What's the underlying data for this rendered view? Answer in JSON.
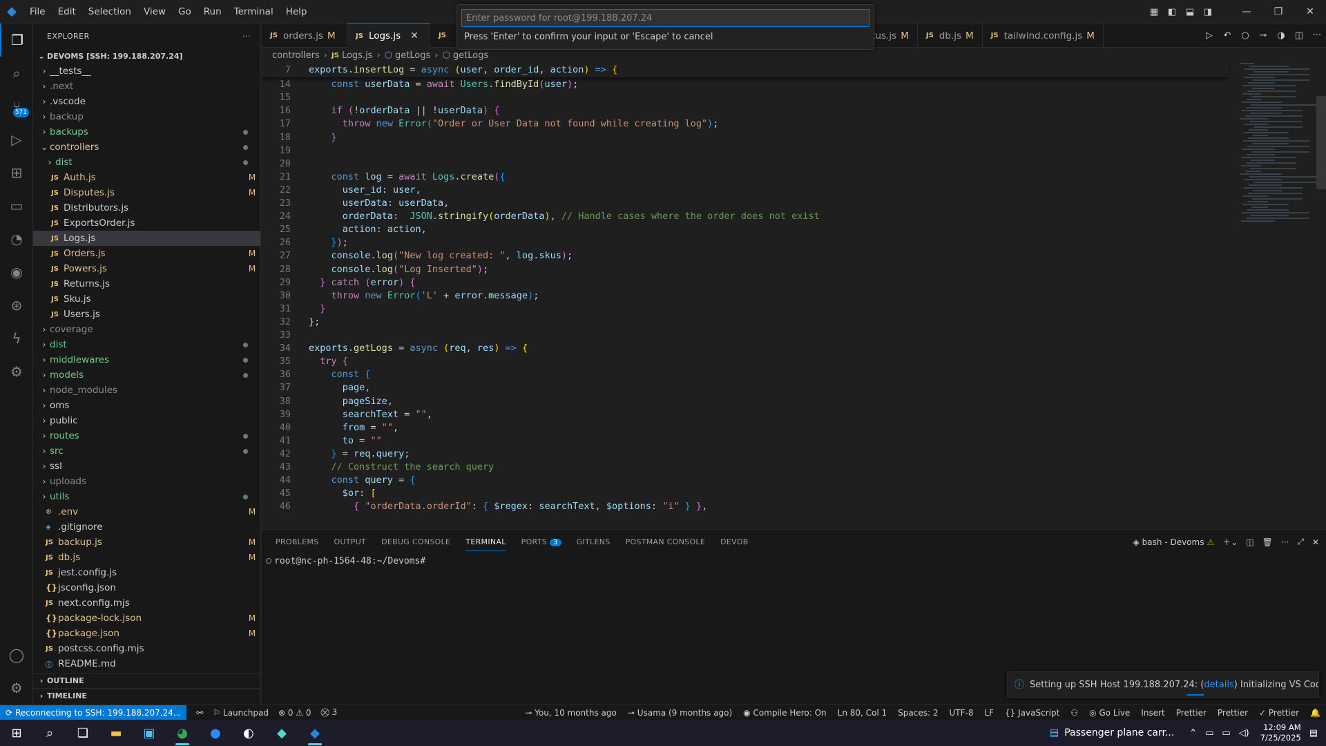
{
  "menu": [
    "File",
    "Edit",
    "Selection",
    "View",
    "Go",
    "Run",
    "Terminal",
    "Help"
  ],
  "quick_input": {
    "placeholder": "Enter password for root@199.188.207.24",
    "hint": "Press 'Enter' to confirm your input or 'Escape' to cancel"
  },
  "activity": {
    "scm_badge": "571"
  },
  "explorer": {
    "title": "EXPLORER",
    "root": "DEVOMS [SSH: 199.188.207.24]",
    "items": [
      {
        "label": "__tests__",
        "type": "folder",
        "indent": 0,
        "open": false,
        "status": "",
        "color": "norm"
      },
      {
        "label": ".next",
        "type": "folder",
        "indent": 0,
        "open": false,
        "status": "",
        "color": "dim"
      },
      {
        "label": ".vscode",
        "type": "folder",
        "indent": 0,
        "open": false,
        "status": "",
        "color": "norm"
      },
      {
        "label": "backup",
        "type": "folder",
        "indent": 0,
        "open": false,
        "status": "",
        "color": "dim"
      },
      {
        "label": "backups",
        "type": "folder",
        "indent": 0,
        "open": false,
        "status": "dot",
        "color": "green"
      },
      {
        "label": "controllers",
        "type": "folder",
        "indent": 0,
        "open": true,
        "status": "dot",
        "color": "mod"
      },
      {
        "label": "dist",
        "type": "folder",
        "indent": 1,
        "open": false,
        "status": "dot",
        "color": "green"
      },
      {
        "label": "Auth.js",
        "type": "js",
        "indent": 1,
        "status": "M",
        "color": "mod"
      },
      {
        "label": "Disputes.js",
        "type": "js",
        "indent": 1,
        "status": "M",
        "color": "mod"
      },
      {
        "label": "Distributors.js",
        "type": "js",
        "indent": 1,
        "status": "",
        "color": "norm"
      },
      {
        "label": "ExportsOrder.js",
        "type": "js",
        "indent": 1,
        "status": "",
        "color": "norm"
      },
      {
        "label": "Logs.js",
        "type": "js",
        "indent": 1,
        "status": "",
        "color": "norm",
        "selected": true
      },
      {
        "label": "Orders.js",
        "type": "js",
        "indent": 1,
        "status": "M",
        "color": "mod"
      },
      {
        "label": "Powers.js",
        "type": "js",
        "indent": 1,
        "status": "M",
        "color": "mod"
      },
      {
        "label": "Returns.js",
        "type": "js",
        "indent": 1,
        "status": "",
        "color": "norm"
      },
      {
        "label": "Sku.js",
        "type": "js",
        "indent": 1,
        "status": "",
        "color": "norm"
      },
      {
        "label": "Users.js",
        "type": "js",
        "indent": 1,
        "status": "",
        "color": "norm"
      },
      {
        "label": "coverage",
        "type": "folder",
        "indent": 0,
        "open": false,
        "status": "",
        "color": "dim"
      },
      {
        "label": "dist",
        "type": "folder",
        "indent": 0,
        "open": false,
        "status": "dot",
        "color": "green"
      },
      {
        "label": "middlewares",
        "type": "folder",
        "indent": 0,
        "open": false,
        "status": "dot",
        "color": "green"
      },
      {
        "label": "models",
        "type": "folder",
        "indent": 0,
        "open": false,
        "status": "dot",
        "color": "green"
      },
      {
        "label": "node_modules",
        "type": "folder",
        "indent": 0,
        "open": false,
        "status": "",
        "color": "dim"
      },
      {
        "label": "oms",
        "type": "folder",
        "indent": 0,
        "open": false,
        "status": "",
        "color": "norm"
      },
      {
        "label": "public",
        "type": "folder",
        "indent": 0,
        "open": false,
        "status": "",
        "color": "norm"
      },
      {
        "label": "routes",
        "type": "folder",
        "indent": 0,
        "open": false,
        "status": "dot",
        "color": "green"
      },
      {
        "label": "src",
        "type": "folder",
        "indent": 0,
        "open": false,
        "status": "dot",
        "color": "green"
      },
      {
        "label": "ssl",
        "type": "folder",
        "indent": 0,
        "open": false,
        "status": "",
        "color": "norm"
      },
      {
        "label": "uploads",
        "type": "folder",
        "indent": 0,
        "open": false,
        "status": "",
        "color": "dim"
      },
      {
        "label": "utils",
        "type": "folder",
        "indent": 0,
        "open": false,
        "status": "dot",
        "color": "green"
      },
      {
        "label": ".env",
        "type": "env",
        "indent": 0,
        "status": "M",
        "color": "mod"
      },
      {
        "label": ".gitignore",
        "type": "git",
        "indent": 0,
        "status": "",
        "color": "norm"
      },
      {
        "label": "backup.js",
        "type": "js",
        "indent": 0,
        "status": "M",
        "color": "mod"
      },
      {
        "label": "db.js",
        "type": "js",
        "indent": 0,
        "status": "M",
        "color": "mod"
      },
      {
        "label": "jest.config.js",
        "type": "js",
        "indent": 0,
        "status": "",
        "color": "norm"
      },
      {
        "label": "jsconfig.json",
        "type": "json",
        "indent": 0,
        "status": "",
        "color": "norm"
      },
      {
        "label": "next.config.mjs",
        "type": "js",
        "indent": 0,
        "status": "",
        "color": "norm"
      },
      {
        "label": "package-lock.json",
        "type": "json",
        "indent": 0,
        "status": "M",
        "color": "mod"
      },
      {
        "label": "package.json",
        "type": "json",
        "indent": 0,
        "status": "M",
        "color": "mod"
      },
      {
        "label": "postcss.config.mjs",
        "type": "js",
        "indent": 0,
        "status": "",
        "color": "norm"
      },
      {
        "label": "README.md",
        "type": "info",
        "indent": 0,
        "status": "",
        "color": "norm"
      }
    ],
    "outline": "OUTLINE",
    "timeline": "TIMELINE"
  },
  "tabs": [
    {
      "label": "orders.js",
      "modified": "M",
      "active": false
    },
    {
      "label": "Logs.js",
      "modified": "",
      "active": true
    },
    {
      "label": "",
      "modified": "",
      "active": false,
      "hidden": true
    },
    {
      "label": "HandleSkus.js",
      "modified": "M",
      "active": false
    },
    {
      "label": "db.js",
      "modified": "M",
      "active": false
    },
    {
      "label": "tailwind.config.js",
      "modified": "M",
      "active": false
    }
  ],
  "breadcrumb": [
    "controllers",
    "Logs.js",
    "getLogs",
    "getLogs"
  ],
  "code": [
    {
      "n": "13",
      "html": ""
    },
    {
      "n": "14",
      "html": "    <span class='k'>const</span> <span class='v'>userData</span> = <span class='kw'>await</span> <span class='cl'>Users</span>.<span class='f'>findById</span><span class='pp'>(</span><span class='v'>user</span><span class='pp'>)</span>;"
    },
    {
      "n": "15",
      "html": ""
    },
    {
      "n": "16",
      "html": "    <span class='kw'>if</span> <span class='pp'>(</span>!<span class='v'>orderData</span> || !<span class='v'>userData</span><span class='pp'>)</span> <span class='pp'>{</span>"
    },
    {
      "n": "17",
      "html": "      <span class='kw'>throw</span> <span class='k'>new</span> <span class='cl'>Error</span><span class='pb'>(</span><span class='s'>\"Order or User Data not found while creating log\"</span><span class='pb'>)</span>;"
    },
    {
      "n": "18",
      "html": "    <span class='pp'>}</span>"
    },
    {
      "n": "19",
      "html": ""
    },
    {
      "n": "20",
      "html": ""
    },
    {
      "n": "21",
      "html": "    <span class='k'>const</span> <span class='v'>log</span> = <span class='kw'>await</span> <span class='cl'>Logs</span>.<span class='f'>create</span><span class='pp'>(</span><span class='pb'>{</span>"
    },
    {
      "n": "22",
      "html": "      <span class='v'>user_id</span>: <span class='v'>user</span>,"
    },
    {
      "n": "23",
      "html": "      <span class='v'>userData</span>: <span class='v'>userData</span>,"
    },
    {
      "n": "24",
      "html": "      <span class='v'>orderData</span>:  <span class='cl'>JSON</span>.<span class='f'>stringify</span><span class='p'>(</span><span class='v'>orderData</span><span class='p'>)</span>, <span class='cm'>// Handle cases where the order does not exist</span>"
    },
    {
      "n": "25",
      "html": "      <span class='v'>action</span>: <span class='v'>action</span>,"
    },
    {
      "n": "26",
      "html": "    <span class='pb'>}</span><span class='pp'>)</span>;"
    },
    {
      "n": "27",
      "html": "    <span class='v'>console</span>.<span class='f'>log</span><span class='pp'>(</span><span class='s'>\"New log created: \"</span>, <span class='v'>log</span>.<span class='v'>skus</span><span class='pp'>)</span>;"
    },
    {
      "n": "28",
      "html": "    <span class='v'>console</span>.<span class='f'>log</span><span class='pp'>(</span><span class='s'>\"Log Inserted\"</span><span class='pp'>)</span>;"
    },
    {
      "n": "29",
      "html": "  <span class='pp'>}</span> <span class='kw'>catch</span> <span class='pp'>(</span><span class='v'>error</span><span class='pp'>)</span> <span class='pp'>{</span>"
    },
    {
      "n": "30",
      "html": "    <span class='kw'>throw</span> <span class='k'>new</span> <span class='cl'>Error</span><span class='pb'>(</span><span class='s'>'L'</span> + <span class='v'>error</span>.<span class='v'>message</span><span class='pb'>)</span>;"
    },
    {
      "n": "31",
      "html": "  <span class='pp'>}</span>"
    },
    {
      "n": "32",
      "html": "<span class='p'>}</span>;"
    },
    {
      "n": "33",
      "html": ""
    },
    {
      "n": "34",
      "html": "<span class='v'>exports</span>.<span class='f'>getLogs</span> = <span class='k'>async</span> <span class='p'>(</span><span class='v'>req</span>, <span class='v'>res</span><span class='p'>)</span> <span class='k'>=&gt;</span> <span class='p'>{</span>"
    },
    {
      "n": "35",
      "html": "  <span class='kw'>try</span> <span class='pp'>{</span>"
    },
    {
      "n": "36",
      "html": "    <span class='k'>const</span> <span class='pb'>{</span>"
    },
    {
      "n": "37",
      "html": "      <span class='v'>page</span>,"
    },
    {
      "n": "38",
      "html": "      <span class='v'>pageSize</span>,"
    },
    {
      "n": "39",
      "html": "      <span class='v'>searchText</span> = <span class='s'>\"\"</span>,"
    },
    {
      "n": "40",
      "html": "      <span class='v'>from</span> = <span class='s'>\"\"</span>,"
    },
    {
      "n": "41",
      "html": "      <span class='v'>to</span> = <span class='s'>\"\"</span>"
    },
    {
      "n": "42",
      "html": "    <span class='pb'>}</span> = <span class='v'>req</span>.<span class='v'>query</span>;"
    },
    {
      "n": "43",
      "html": "    <span class='cm'>// Construct the search query</span>"
    },
    {
      "n": "44",
      "html": "    <span class='k'>const</span> <span class='v'>query</span> = <span class='pb'>{</span>"
    },
    {
      "n": "45",
      "html": "      <span class='v'>$or</span>: <span class='p'>[</span>"
    },
    {
      "n": "46",
      "html": "        <span class='pp'>{</span> <span class='s'>\"orderData.orderId\"</span>: <span class='pb'>{</span> <span class='v'>$regex</span>: <span class='v'>searchText</span>, <span class='v'>$options</span>: <span class='s'>\"i\"</span> <span class='pb'>}</span> <span class='pp'>}</span>,"
    }
  ],
  "sticky": {
    "n": "7",
    "html": "<span class='v'>exports</span>.<span class='f'>insertLog</span> = <span class='k'>async</span> <span class='p'>(</span><span class='v'>user</span>, <span class='v'>order_id</span>, <span class='v'>action</span><span class='p'>)</span> <span class='k'>=&gt;</span> <span class='p'>{</span>"
  },
  "panel": {
    "tabs": [
      "PROBLEMS",
      "OUTPUT",
      "DEBUG CONSOLE",
      "TERMINAL",
      "PORTS",
      "GITLENS",
      "POSTMAN CONSOLE",
      "DEVDB"
    ],
    "active_tab": "TERMINAL",
    "ports_count": "3",
    "shell": "bash - Devoms",
    "prompt": "root@nc-ph-1564-48:~/Devoms#"
  },
  "notification": {
    "prefix": "Setting up SSH Host 199.188.207.24: (",
    "link": "details",
    "suffix": ") Initializing VS Code Server"
  },
  "status": {
    "remote": "Reconnecting to SSH: 199.188.207.24...",
    "launchpad": "Launchpad",
    "errors": "0",
    "warnings": "0",
    "ports": "3",
    "blame": "You, 10 months ago",
    "author": "Usama (9 months ago)",
    "compile_hero": "Compile Hero: On",
    "position": "Ln 80, Col 1",
    "spaces": "Spaces: 2",
    "encoding": "UTF-8",
    "eol": "LF",
    "language": "JavaScript",
    "golive": "Go Live",
    "mode": "Insert",
    "prettier1": "Prettier",
    "prettier2": "Prettier",
    "prettier3": "Prettier"
  },
  "taskbar": {
    "news": "Passenger plane carr...",
    "time": "12:09 AM",
    "date": "7/25/2025"
  }
}
